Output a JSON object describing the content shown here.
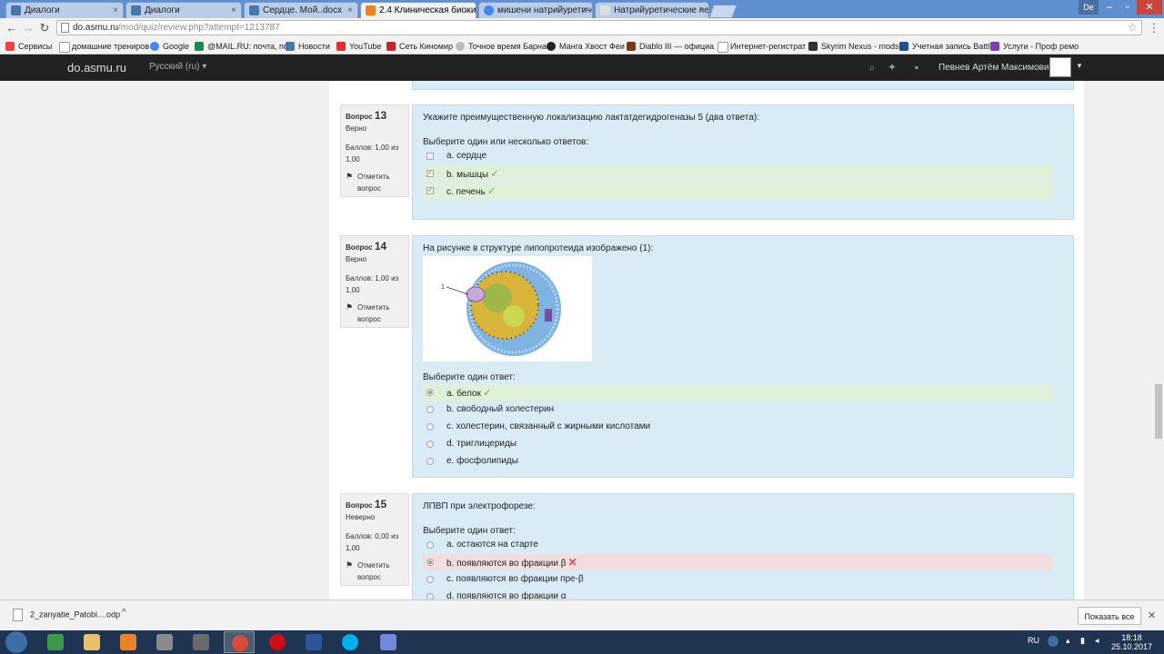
{
  "browser": {
    "tabs": [
      {
        "label": "Диалоги",
        "active": false
      },
      {
        "label": "Диалоги",
        "active": false
      },
      {
        "label": "Сердце. Мой..docx",
        "active": false
      },
      {
        "label": "2.4 Клиническая биохи...",
        "active": true
      },
      {
        "label": "мишени натрийуретиче...",
        "active": false
      },
      {
        "label": "Натрийуретические пеп...",
        "active": false
      }
    ],
    "tab_close": "×",
    "window_user": "De",
    "url_host": "do.asmu.ru",
    "url_path": "/mod/quiz/review.php?attempt=1213787",
    "bookmarks": [
      "Сервисы",
      "домашние трениров",
      "Google",
      "@MAIL.RU: почта, по",
      "Новости",
      "YouTube",
      "Сеть Киномир",
      "Точное время Барна",
      "Манга Хвост Феи",
      "Diablo III — официа",
      "Интернет-регистрат",
      "Skyrim Nexus - mods",
      "Учетная запись Battl",
      "Услуги - Проф ремо"
    ]
  },
  "site": {
    "brand": "do.asmu.ru",
    "language": "Русский (ru)",
    "username": "Певнев Артём Максимович"
  },
  "questions": [
    {
      "label": "Вопрос",
      "number": "13",
      "state": "Верно",
      "grade": "Баллов: 1,00 из 1,00",
      "flag": "Отметить вопрос",
      "text": "Укажите преимущественную локализацию лактатдегидрогеназы 5 (два ответа):",
      "prompt": "Выберите один или несколько ответов:",
      "answers": [
        {
          "label": "a. сердце",
          "checked": false,
          "result": ""
        },
        {
          "label": "b. мышцы",
          "checked": true,
          "result": "correct"
        },
        {
          "label": "c. печень",
          "checked": true,
          "result": "correct"
        }
      ]
    },
    {
      "label": "Вопрос",
      "number": "14",
      "state": "Верно",
      "grade": "Баллов: 1,00 из 1,00",
      "flag": "Отметить вопрос",
      "text": "На рисунке в структуре липопротеида изображено (1):",
      "figure_label": "1",
      "prompt": "Выберите один ответ:",
      "answers": [
        {
          "label": "a. белок",
          "checked": true,
          "result": "correct"
        },
        {
          "label": "b. свободный холестерин",
          "checked": false,
          "result": ""
        },
        {
          "label": "c. холестерин, связанный с жирными кислотами",
          "checked": false,
          "result": ""
        },
        {
          "label": "d. триглицериды",
          "checked": false,
          "result": ""
        },
        {
          "label": "e. фосфолипиды",
          "checked": false,
          "result": ""
        }
      ]
    },
    {
      "label": "Вопрос",
      "number": "15",
      "state": "Неверно",
      "grade": "Баллов: 0,00 из 1,00",
      "flag": "Отметить вопрос",
      "text": "ЛПВП при электрофорезе:",
      "prompt": "Выберите один ответ:",
      "answers": [
        {
          "label": "a. остаются на старте",
          "checked": false,
          "result": ""
        },
        {
          "label": "b. появляются во фракции β",
          "checked": true,
          "result": "incorrect"
        },
        {
          "label": "c. появляются во фракции пре-β",
          "checked": false,
          "result": ""
        },
        {
          "label": "d. появляются во фракции α",
          "checked": false,
          "result": ""
        }
      ]
    }
  ],
  "downloads": {
    "file": "2_zanyatie_Patobi....odp",
    "show_all": "Показать все"
  },
  "taskbar": {
    "lang": "RU",
    "time": "18:18",
    "date": "25.10.2017"
  },
  "marks": {
    "ok": "✓",
    "bad": "✕"
  },
  "colors": {
    "question_bg": "#d9ecf6",
    "correct_bg": "#dff0d8",
    "incorrect_bg": "#f2dede",
    "navbar": "#222222"
  }
}
